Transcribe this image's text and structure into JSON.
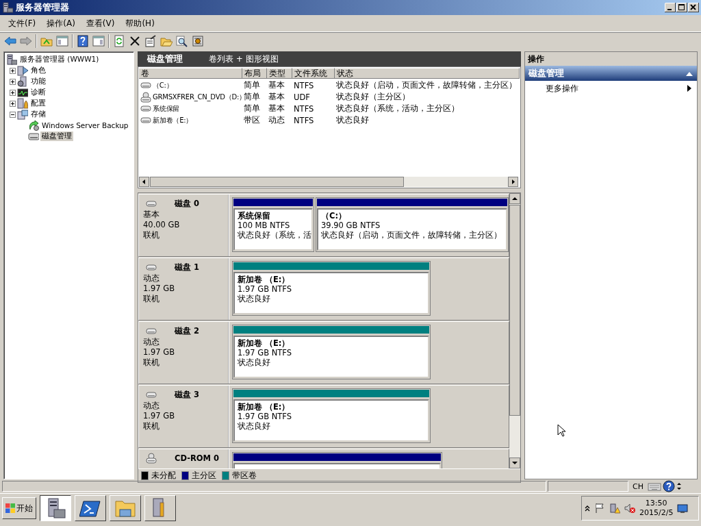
{
  "window": {
    "title": "服务器管理器"
  },
  "menu": [
    "文件(F)",
    "操作(A)",
    "查看(V)",
    "帮助(H)"
  ],
  "tree": {
    "label": "服务器管理器 (WWW1)",
    "selected": false,
    "children": [
      {
        "label": "角色",
        "expanded": false,
        "selected": false,
        "kind": "roles"
      },
      {
        "label": "功能",
        "expanded": false,
        "selected": false,
        "kind": "features"
      },
      {
        "label": "诊断",
        "expanded": false,
        "selected": false,
        "kind": "diagnostics"
      },
      {
        "label": "配置",
        "expanded": false,
        "selected": false,
        "kind": "configuration"
      },
      {
        "label": "存储",
        "expanded": true,
        "selected": false,
        "kind": "storage",
        "children": [
          {
            "label": "Windows Server Backup",
            "selected": false,
            "kind": "backup"
          },
          {
            "label": "磁盘管理",
            "selected": true,
            "kind": "disk"
          }
        ]
      }
    ]
  },
  "center_header": {
    "title": "磁盘管理",
    "view": "卷列表 + 图形视图"
  },
  "volume_table": {
    "columns": [
      "卷",
      "布局",
      "类型",
      "文件系统",
      "状态"
    ],
    "rows": [
      {
        "kind": "disk",
        "cells": [
          "（C:）",
          "简单",
          "基本",
          "NTFS",
          "状态良好（启动，页面文件，故障转储，主分区）"
        ]
      },
      {
        "kind": "dvd",
        "cells": [
          "GRMSXFRER_CN_DVD（D:）",
          "简单",
          "基本",
          "UDF",
          "状态良好（主分区）"
        ]
      },
      {
        "kind": "disk",
        "cells": [
          "系统保留",
          "简单",
          "基本",
          "NTFS",
          "状态良好（系统，活动，主分区）"
        ]
      },
      {
        "kind": "disk",
        "cells": [
          "新加卷（E:）",
          "带区",
          "动态",
          "NTFS",
          "状态良好"
        ]
      }
    ]
  },
  "disks": [
    {
      "kind": "disk",
      "name": "磁盘 0",
      "type": "基本",
      "size": "40.00 GB",
      "status": "联机",
      "partitions": [
        {
          "kind": "primary",
          "label": "系统保留",
          "detail": "100 MB NTFS",
          "status": "状态良好（系统，活"
        },
        {
          "kind": "primary",
          "label": "（C:）",
          "detail": "39.90 GB NTFS",
          "status": "状态良好（启动，页面文件，故障转储，主分区）"
        }
      ]
    },
    {
      "kind": "disk",
      "name": "磁盘 1",
      "type": "动态",
      "size": "1.97 GB",
      "status": "联机",
      "partitions": [
        {
          "kind": "striped",
          "label": "新加卷 （E:）",
          "detail": "1.97 GB NTFS",
          "status": "状态良好"
        }
      ]
    },
    {
      "kind": "disk",
      "name": "磁盘 2",
      "type": "动态",
      "size": "1.97 GB",
      "status": "联机",
      "partitions": [
        {
          "kind": "striped",
          "label": "新加卷 （E:）",
          "detail": "1.97 GB NTFS",
          "status": "状态良好"
        }
      ]
    },
    {
      "kind": "disk",
      "name": "磁盘 3",
      "type": "动态",
      "size": "1.97 GB",
      "status": "联机",
      "partitions": [
        {
          "kind": "striped",
          "label": "新加卷 （E:）",
          "detail": "1.97 GB NTFS",
          "status": "状态良好"
        }
      ]
    },
    {
      "kind": "dvd",
      "name": "CD-ROM 0",
      "partitions": [
        {
          "kind": "primary"
        }
      ]
    }
  ],
  "legend": [
    {
      "label": "未分配",
      "color": "#000000"
    },
    {
      "label": "主分区",
      "color": "#000080"
    },
    {
      "label": "带区卷",
      "color": "#008080"
    }
  ],
  "actions": {
    "title": "操作",
    "section": {
      "label": "磁盘管理",
      "expanded": true
    },
    "items": [
      {
        "label": "更多操作",
        "kind": "submenu"
      }
    ]
  },
  "status_bar": {
    "language": "CH"
  },
  "taskbar": {
    "start": "开始",
    "tasks": [
      {
        "kind": "server",
        "selected": true
      },
      {
        "kind": "powershell",
        "selected": false
      },
      {
        "kind": "explorer",
        "selected": false
      },
      {
        "kind": "tools",
        "selected": false
      }
    ],
    "time": "13:50",
    "date": "2015/2/5"
  }
}
